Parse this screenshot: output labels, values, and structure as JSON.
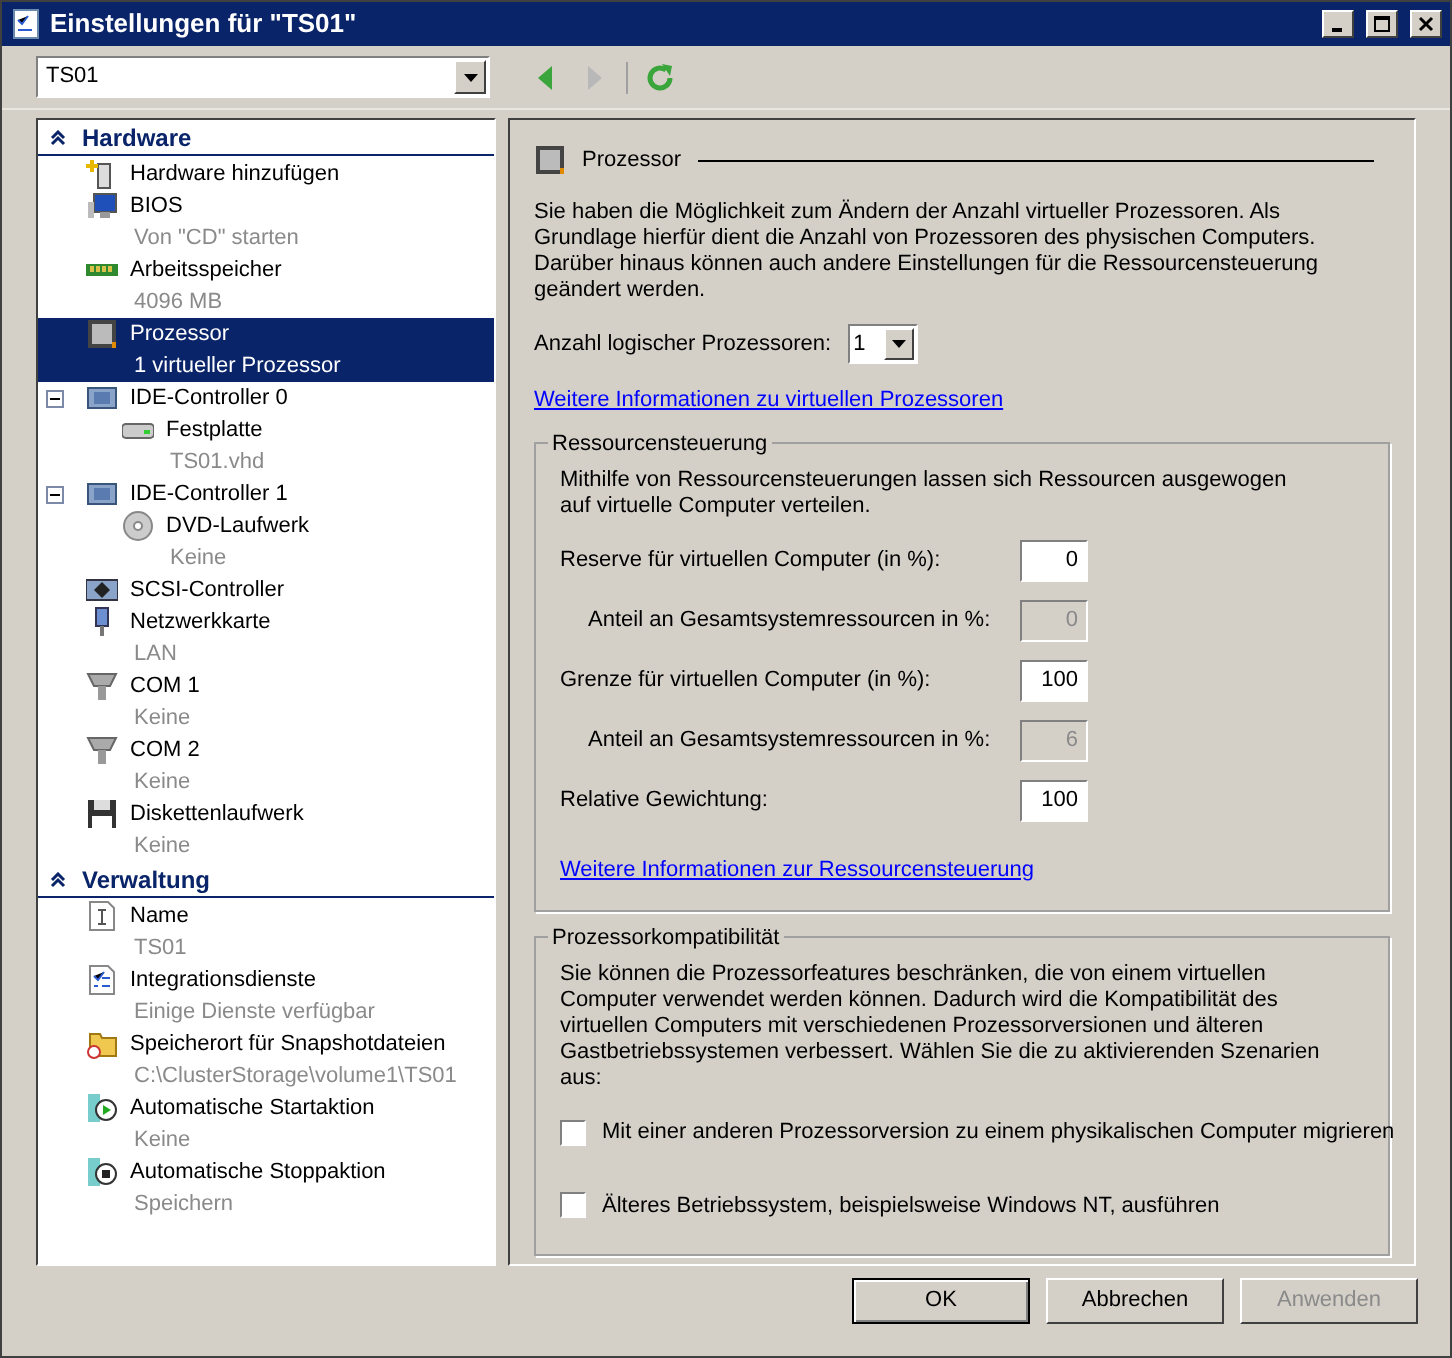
{
  "window": {
    "title": "Einstellungen für \"TS01\""
  },
  "toolbar": {
    "machine": "TS01",
    "buttons": [
      {
        "kind": "back",
        "disabled": false
      },
      {
        "kind": "forward",
        "disabled": true
      },
      {
        "kind": "refresh",
        "disabled": false
      }
    ]
  },
  "sidebar": {
    "sections": [
      {
        "title": "Hardware",
        "expanded": true,
        "items": [
          {
            "kind": "add",
            "label": "Hardware hinzufügen",
            "selected": false
          },
          {
            "kind": "bios",
            "label": "BIOS",
            "detail": "Von \"CD\" starten",
            "selected": false
          },
          {
            "kind": "memory",
            "label": "Arbeitsspeicher",
            "detail": "4096 MB",
            "selected": false
          },
          {
            "kind": "cpu",
            "label": "Prozessor",
            "detail": "1 virtueller Prozessor",
            "selected": true
          },
          {
            "kind": "controller",
            "label": "IDE-Controller 0",
            "selected": false,
            "expanded": true,
            "children": [
              {
                "kind": "disk",
                "label": "Festplatte",
                "detail": "TS01.vhd",
                "selected": false
              }
            ]
          },
          {
            "kind": "controller",
            "label": "IDE-Controller 1",
            "selected": false,
            "expanded": true,
            "children": [
              {
                "kind": "dvd",
                "label": "DVD-Laufwerk",
                "detail": "Keine",
                "selected": false
              }
            ]
          },
          {
            "kind": "scsi",
            "label": "SCSI-Controller",
            "selected": false
          },
          {
            "kind": "network",
            "label": "Netzwerkkarte",
            "detail": "LAN",
            "selected": false
          },
          {
            "kind": "com",
            "label": "COM 1",
            "detail": "Keine",
            "selected": false
          },
          {
            "kind": "com",
            "label": "COM 2",
            "detail": "Keine",
            "selected": false
          },
          {
            "kind": "floppy",
            "label": "Diskettenlaufwerk",
            "detail": "Keine",
            "selected": false
          }
        ]
      },
      {
        "title": "Verwaltung",
        "expanded": true,
        "items": [
          {
            "kind": "name",
            "label": "Name",
            "detail": "TS01",
            "selected": false
          },
          {
            "kind": "services",
            "label": "Integrationsdienste",
            "detail": "Einige Dienste verfügbar",
            "selected": false
          },
          {
            "kind": "folder",
            "label": "Speicherort für Snapshotdateien",
            "detail": "C:\\ClusterStorage\\volume1\\TS01",
            "selected": false
          },
          {
            "kind": "start",
            "label": "Automatische Startaktion",
            "detail": "Keine",
            "selected": false
          },
          {
            "kind": "stop",
            "label": "Automatische Stoppaktion",
            "detail": "Speichern",
            "selected": false
          }
        ]
      }
    ]
  },
  "panel": {
    "heading": "Prozessor",
    "intro": "Sie haben die Möglichkeit zum Ändern der Anzahl virtueller Prozessoren. Als Grundlage hierfür dient die Anzahl von Prozessoren des physischen Computers. Darüber hinaus können auch andere Einstellungen für die Ressourcensteuerung geändert werden.",
    "count": {
      "label": "Anzahl logischer Prozessoren:",
      "value": "1"
    },
    "link": "Weitere Informationen zu virtuellen Prozessoren",
    "resources": {
      "title": "Ressourcensteuerung",
      "description": "Mithilfe von Ressourcensteuerungen lassen sich Ressourcen ausgewogen auf virtuelle Computer verteilen.",
      "fields": [
        {
          "label": "Reserve für virtuellen Computer (in %):",
          "value": "0",
          "disabled": false
        },
        {
          "label": "Anteil an Gesamtsystemressourcen in %:",
          "value": "0",
          "disabled": true
        },
        {
          "label": "Grenze für virtuellen Computer (in %):",
          "value": "100",
          "disabled": false
        },
        {
          "label": "Anteil an Gesamtsystemressourcen in %:",
          "value": "6",
          "disabled": true
        },
        {
          "label": "Relative Gewichtung:",
          "value": "100",
          "disabled": false
        }
      ],
      "link": "Weitere Informationen zur Ressourcensteuerung"
    },
    "compatibility": {
      "title": "Prozessorkompatibilität",
      "description": "Sie können die Prozessorfeatures beschränken, die von einem virtuellen Computer verwendet werden können. Dadurch wird die Kompatibilität des virtuellen Computers mit verschiedenen Prozessorversionen und älteren Gastbetriebssystemen verbessert. Wählen Sie die zu aktivierenden Szenarien aus:",
      "options": [
        {
          "label": "Mit einer anderen Prozessorversion zu einem physikalischen Computer migrieren",
          "checked": false
        },
        {
          "label": "Älteres Betriebssystem, beispielsweise Windows NT, ausführen",
          "checked": false
        }
      ]
    }
  },
  "buttons": [
    {
      "label": "OK",
      "default": true,
      "disabled": false
    },
    {
      "label": "Abbrechen",
      "default": false,
      "disabled": false
    },
    {
      "label": "Anwenden",
      "default": false,
      "disabled": true
    }
  ]
}
